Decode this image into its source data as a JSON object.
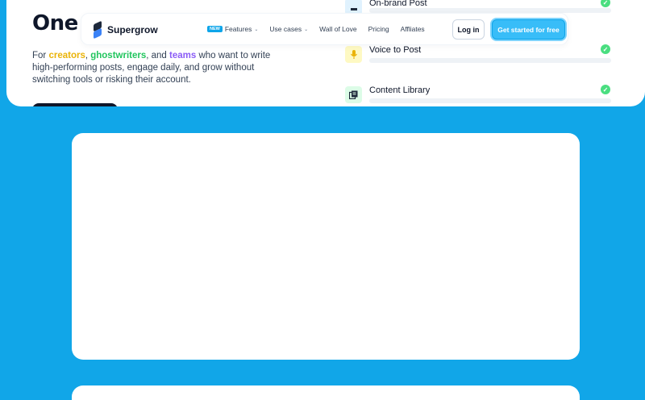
{
  "hero": {
    "heading": "One p",
    "description_prefix": "For ",
    "creators": "creators",
    "sep1": ", ",
    "ghostwriters": "ghostwriters",
    "sep2": ", and ",
    "teams": "teams",
    "description_suffix": " who want to write high-performing posts, engage daily, and grow without switching tools or risking their account."
  },
  "nav": {
    "brand": "Supergrow",
    "new_badge": "NEW",
    "items": [
      "Features",
      "Use cases",
      "Wall of Love",
      "Pricing",
      "Affliates"
    ],
    "login": "Log in",
    "cta": "Get started for free"
  },
  "features": [
    {
      "label": "On-brand Post",
      "icon": "document-icon",
      "done": true
    },
    {
      "label": "Voice to Post",
      "icon": "microphone-icon",
      "done": true
    },
    {
      "label": "Content Library",
      "icon": "library-icon",
      "done": true
    }
  ],
  "colors": {
    "background": "#11a6e8",
    "accent": "#38bdf8",
    "creators": "#eab308",
    "ghostwriters": "#22c55e",
    "teams": "#8b5cf6",
    "check": "#4ade80"
  }
}
